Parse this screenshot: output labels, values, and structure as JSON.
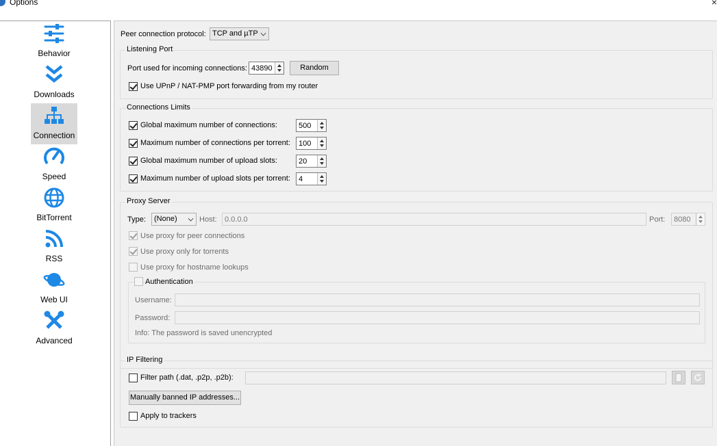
{
  "window": {
    "title": "Options",
    "close_glyph": "×"
  },
  "sidebar": {
    "items": [
      {
        "label": "Behavior",
        "icon": "sliders-icon"
      },
      {
        "label": "Downloads",
        "icon": "double-chevron-down-icon"
      },
      {
        "label": "Connection",
        "icon": "network-icon",
        "selected": true
      },
      {
        "label": "Speed",
        "icon": "speedometer-icon"
      },
      {
        "label": "BitTorrent",
        "icon": "globe-icon"
      },
      {
        "label": "RSS",
        "icon": "rss-icon"
      },
      {
        "label": "Web UI",
        "icon": "planet-icon"
      },
      {
        "label": "Advanced",
        "icon": "tools-icon"
      }
    ],
    "accent": "#1e88e5"
  },
  "connection": {
    "protocol_label": "Peer connection protocol:",
    "protocol_value": "TCP and µTP",
    "listening": {
      "title": "Listening Port",
      "port_label": "Port used for incoming connections:",
      "port_value": "43890",
      "random_label": "Random",
      "upnp_label": "Use UPnP / NAT-PMP port forwarding from my router",
      "upnp_checked": true
    },
    "limits": {
      "title": "Connections Limits",
      "rows": [
        {
          "label": "Global maximum number of connections:",
          "value": "500",
          "checked": true
        },
        {
          "label": "Maximum number of connections per torrent:",
          "value": "100",
          "checked": true
        },
        {
          "label": "Global maximum number of upload slots:",
          "value": "20",
          "checked": true
        },
        {
          "label": "Maximum number of upload slots per torrent:",
          "value": "4",
          "checked": true
        }
      ]
    },
    "proxy": {
      "title": "Proxy Server",
      "type_label": "Type:",
      "type_value": "(None)",
      "host_label": "Host:",
      "host_value": "0.0.0.0",
      "port_label": "Port:",
      "port_value": "8080",
      "peer_label": "Use proxy for peer connections",
      "torrents_label": "Use proxy only for torrents",
      "hostname_label": "Use proxy for hostname lookups",
      "auth_label": "Authentication",
      "username_label": "Username:",
      "password_label": "Password:",
      "info_text": "Info: The password is saved unencrypted"
    },
    "ipfilter": {
      "title": "IP Filtering",
      "filter_label": "Filter path (.dat, .p2p, .p2b):",
      "banned_button": "Manually banned IP addresses...",
      "trackers_label": "Apply to trackers"
    }
  }
}
